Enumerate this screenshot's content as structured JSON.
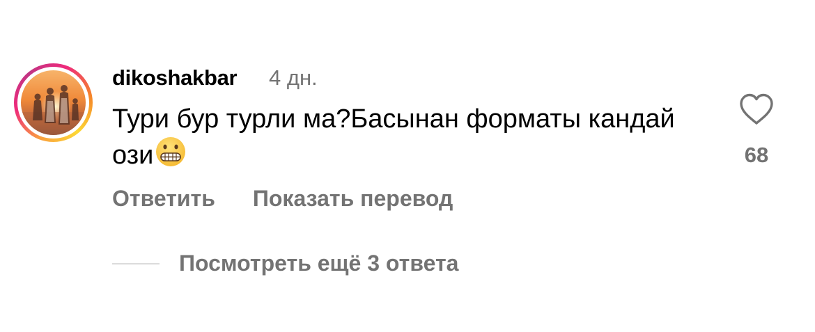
{
  "comment": {
    "username": "dikoshakbar",
    "timestamp": "4 дн.",
    "text": "Тури бур турли ма?Басынан форматы кандай ози",
    "emoji": "grimacing-face",
    "likes": "68"
  },
  "actions": {
    "reply_label": "Ответить",
    "translate_label": "Показать перевод"
  },
  "replies": {
    "label": "Посмотреть ещё 3 ответа"
  },
  "colors": {
    "secondary_text": "#737373",
    "divider": "#dbdbdb",
    "ring_gradient": [
      "#f9a03f",
      "#ee2a7b",
      "#c13584",
      "#fdd835"
    ]
  }
}
